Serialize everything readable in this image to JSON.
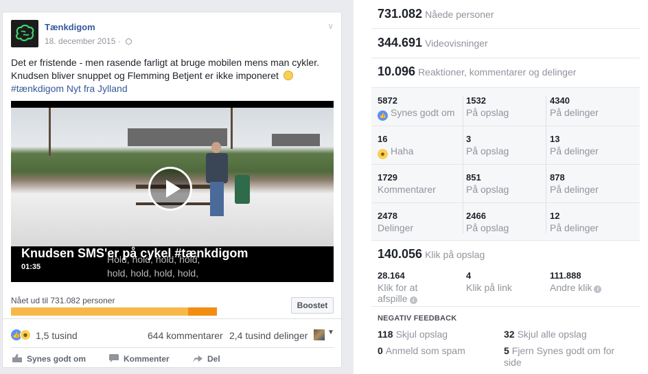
{
  "post": {
    "page_name": "Tænkdigom",
    "date": "18. december 2015",
    "date_sep": " · ",
    "text_line1": "Det er fristende - men rasende farligt at bruge mobilen mens man cykler.",
    "text_line2": "Knudsen bliver snuppet og Flemming Betjent er ikke imponeret",
    "hashtag": "#tænkdigom",
    "hashtag_suffix": " Nyt fra Jylland",
    "video": {
      "title": "Knudsen SMS'er på cykel #tænkdigom",
      "duration": "01:35",
      "subtitle_line1": "Hold, hold, hold, hold,",
      "subtitle_line2": "hold, hold, hold, hold,"
    },
    "reach_text": "Nået ud til 731.082 personer",
    "reach_bar": {
      "organic_fraction": 0.86,
      "paid_fraction": 0.14,
      "organic_color": "#f7b84b",
      "paid_color": "#f28d12"
    },
    "boost_label": "Boostet",
    "reactions_count": "1,5 tusind",
    "comments_count": "644 kommentarer",
    "shares_count": "2,4 tusind delinger",
    "actions": {
      "like": "Synes godt om",
      "comment": "Kommenter",
      "share": "Del"
    }
  },
  "insights": {
    "reach": {
      "value": "731.082",
      "label": "Nåede personer"
    },
    "views": {
      "value": "344.691",
      "label": "Videovisninger"
    },
    "engagement": {
      "value": "10.096",
      "label": "Reaktioner, kommentarer og delinger"
    },
    "grid": [
      [
        {
          "value": "5872",
          "label": "Synes godt om"
        },
        {
          "value": "1532",
          "label": "På opslag"
        },
        {
          "value": "4340",
          "label": "På delinger"
        }
      ],
      [
        {
          "value": "16",
          "label": "Haha"
        },
        {
          "value": "3",
          "label": "På opslag"
        },
        {
          "value": "13",
          "label": "På delinger"
        }
      ],
      [
        {
          "value": "1729",
          "label": "Kommentarer"
        },
        {
          "value": "851",
          "label": "På opslag"
        },
        {
          "value": "878",
          "label": "På delinger"
        }
      ],
      [
        {
          "value": "2478",
          "label": "Delinger"
        },
        {
          "value": "2466",
          "label": "På opslag"
        },
        {
          "value": "12",
          "label": "På delinger"
        }
      ]
    ],
    "clicks": {
      "value": "140.056",
      "label": "Klik på opslag"
    },
    "click_breakdown": [
      {
        "value": "28.164",
        "label_line1": "Klik for at",
        "label_line2": "afspille"
      },
      {
        "value": "4",
        "label_line1": "Klik på link"
      },
      {
        "value": "111.888",
        "label_line1": "Andre klik"
      }
    ],
    "negative_heading": "NEGATIV FEEDBACK",
    "negative": [
      {
        "value": "118",
        "label": "Skjul opslag"
      },
      {
        "value": "32",
        "label": "Skjul alle opslag"
      },
      {
        "value": "0",
        "label": "Anmeld som spam"
      },
      {
        "value": "5",
        "label_line1": "Fjern Synes godt om for",
        "label_line2": "side"
      }
    ]
  }
}
